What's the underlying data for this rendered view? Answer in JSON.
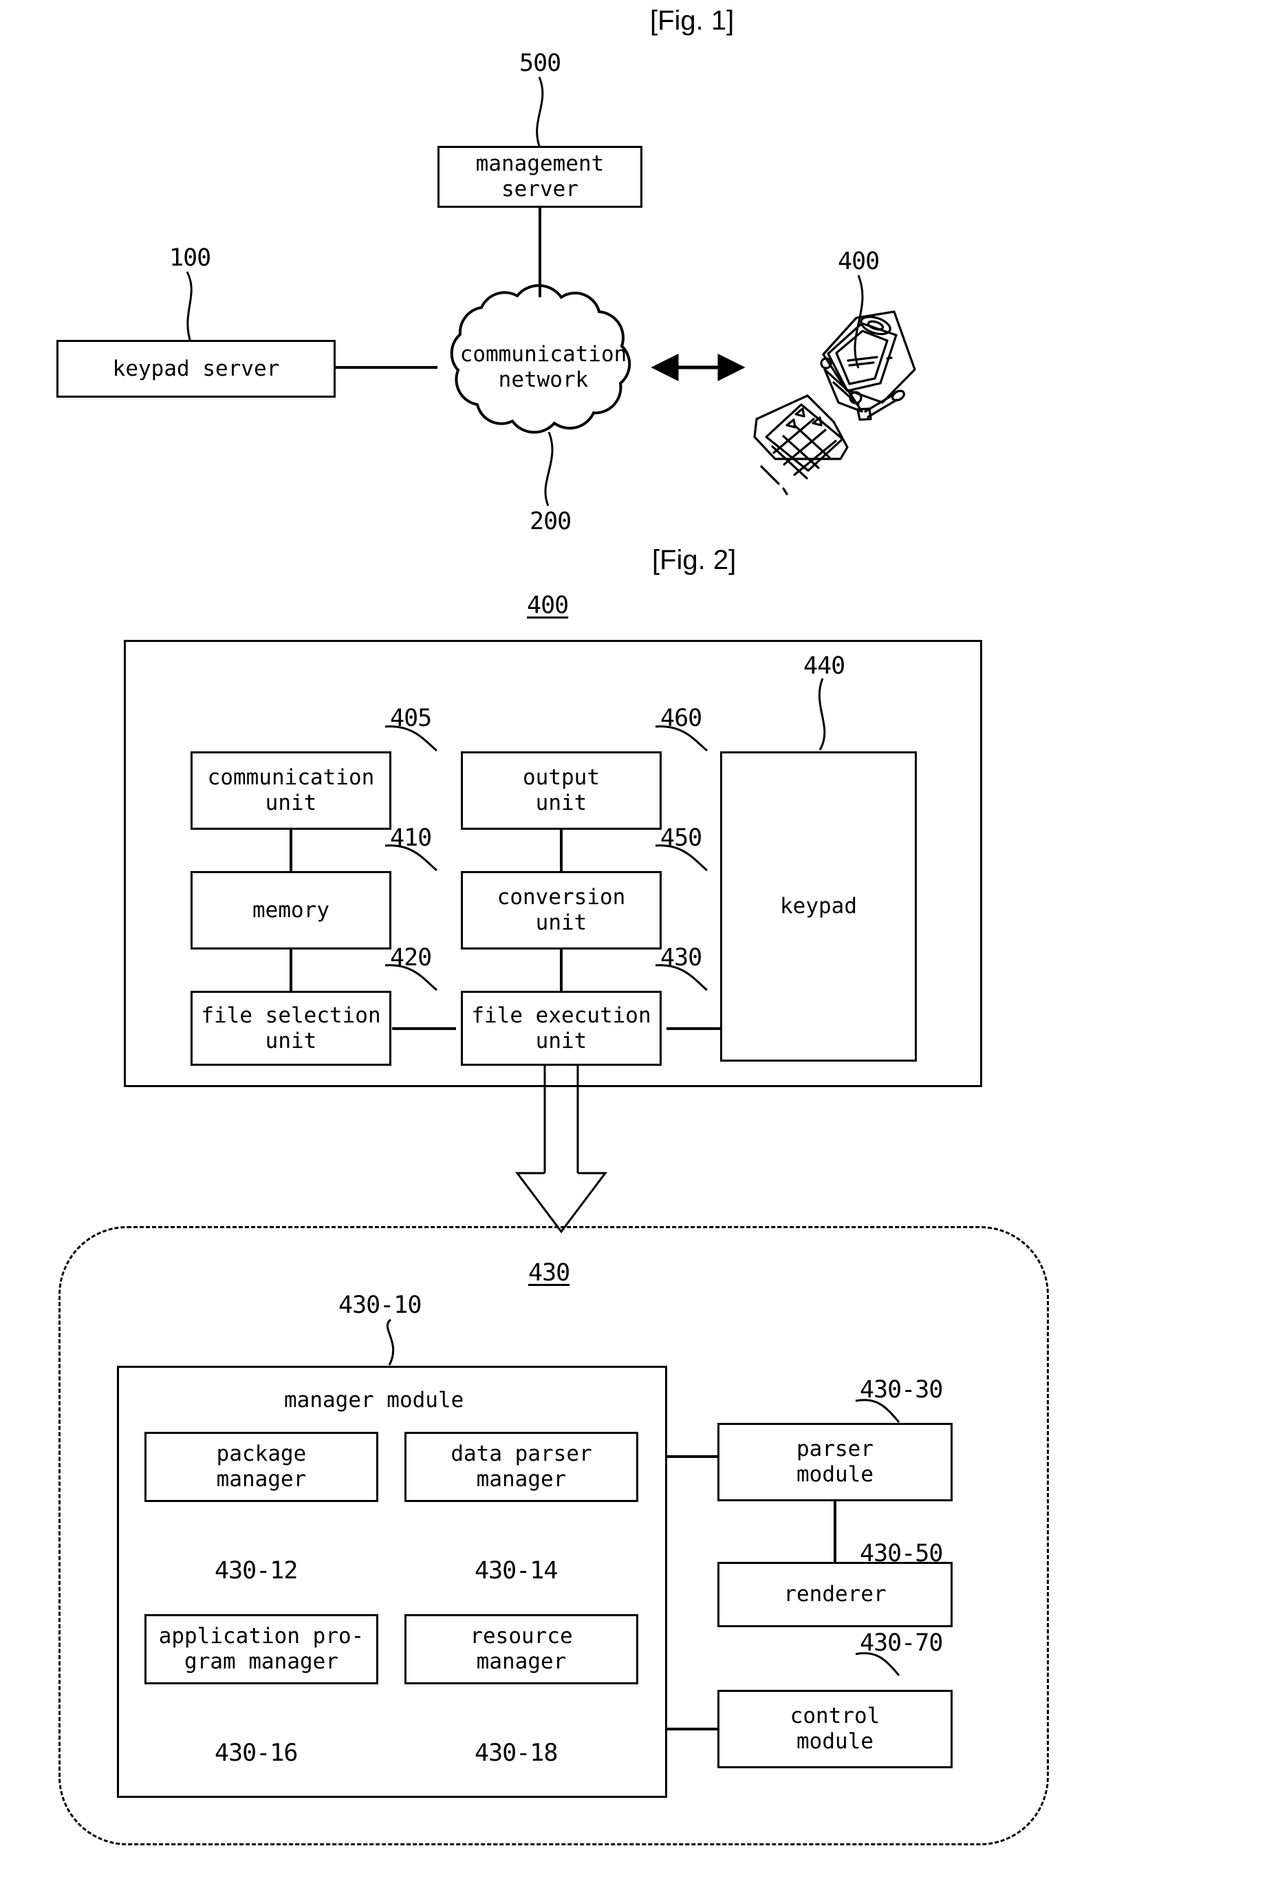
{
  "figures": [
    {
      "title": "[Fig. 1]",
      "nodes": [
        {
          "id": "management_server",
          "label": "management\nserver",
          "ref": "500"
        },
        {
          "id": "keypad_server",
          "label": "keypad server",
          "ref": "100"
        },
        {
          "id": "communication_network",
          "label": "communication\nnetwork",
          "ref": "200"
        },
        {
          "id": "mobile_terminal",
          "label": "",
          "ref": "400"
        }
      ]
    },
    {
      "title": "[Fig. 2]",
      "outer_ref": "400",
      "nodes": [
        {
          "id": "communication_unit",
          "label": "communication\nunit",
          "ref": "405"
        },
        {
          "id": "memory",
          "label": "memory",
          "ref": "410"
        },
        {
          "id": "file_selection_unit",
          "label": "file selection\nunit",
          "ref": "420"
        },
        {
          "id": "output_unit",
          "label": "output\nunit",
          "ref": "460"
        },
        {
          "id": "conversion_unit",
          "label": "conversion\nunit",
          "ref": "450"
        },
        {
          "id": "file_execution_unit",
          "label": "file execution\nunit",
          "ref": "430"
        },
        {
          "id": "keypad",
          "label": "keypad",
          "ref": "440"
        }
      ],
      "detail": {
        "ref": "430",
        "manager_module": {
          "label": "manager module",
          "ref": "430-10",
          "children": [
            {
              "id": "package_manager",
              "label": "package\nmanager",
              "ref": "430-12"
            },
            {
              "id": "data_parser_manager",
              "label": "data parser\nmanager",
              "ref": "430-14"
            },
            {
              "id": "application_program_manager",
              "label": "application pro-\ngram manager",
              "ref": "430-16"
            },
            {
              "id": "resource_manager",
              "label": "resource\nmanager",
              "ref": "430-18"
            }
          ]
        },
        "side_modules": [
          {
            "id": "parser_module",
            "label": "parser\nmodule",
            "ref": "430-30"
          },
          {
            "id": "renderer",
            "label": "renderer",
            "ref": "430-50"
          },
          {
            "id": "control_module",
            "label": "control\nmodule",
            "ref": "430-70"
          }
        ]
      }
    }
  ],
  "labels": {
    "fig1_title": "[Fig. 1]",
    "fig2_title": "[Fig. 2]",
    "ref_500": "500",
    "ref_100": "100",
    "ref_200": "200",
    "ref_400_fig1": "400",
    "ref_400_fig2": "400",
    "ref_405": "405",
    "ref_410": "410",
    "ref_420": "420",
    "ref_430_unit": "430",
    "ref_440": "440",
    "ref_450": "450",
    "ref_460": "460",
    "ref_430_detail": "430",
    "ref_430_10": "430-10",
    "ref_430_12": "430-12",
    "ref_430_14": "430-14",
    "ref_430_16": "430-16",
    "ref_430_18": "430-18",
    "ref_430_30": "430-30",
    "ref_430_50": "430-50",
    "ref_430_70": "430-70",
    "management_server": "management\nserver",
    "keypad_server": "keypad server",
    "communication_network": "communication\nnetwork",
    "communication_unit": "communication\nunit",
    "memory": "memory",
    "file_selection_unit": "file selection\nunit",
    "output_unit": "output\nunit",
    "conversion_unit": "conversion\nunit",
    "file_execution_unit": "file execution\nunit",
    "keypad": "keypad",
    "manager_module": "manager module",
    "package_manager": "package\nmanager",
    "data_parser_manager": "data parser\nmanager",
    "application_program_manager": "application pro-\ngram manager",
    "resource_manager": "resource\nmanager",
    "parser_module": "parser\nmodule",
    "renderer": "renderer",
    "control_module": "control\nmodule"
  },
  "colors": {
    "ink": "#000000",
    "paper": "#ffffff"
  }
}
